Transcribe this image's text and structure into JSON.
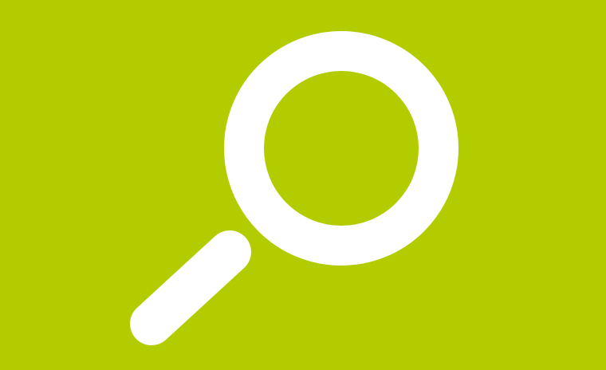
{
  "colors": {
    "background": "#b3cc00",
    "icon": "#ffffff"
  },
  "icon": {
    "name": "search-icon",
    "depicts": "magnifying-glass"
  }
}
